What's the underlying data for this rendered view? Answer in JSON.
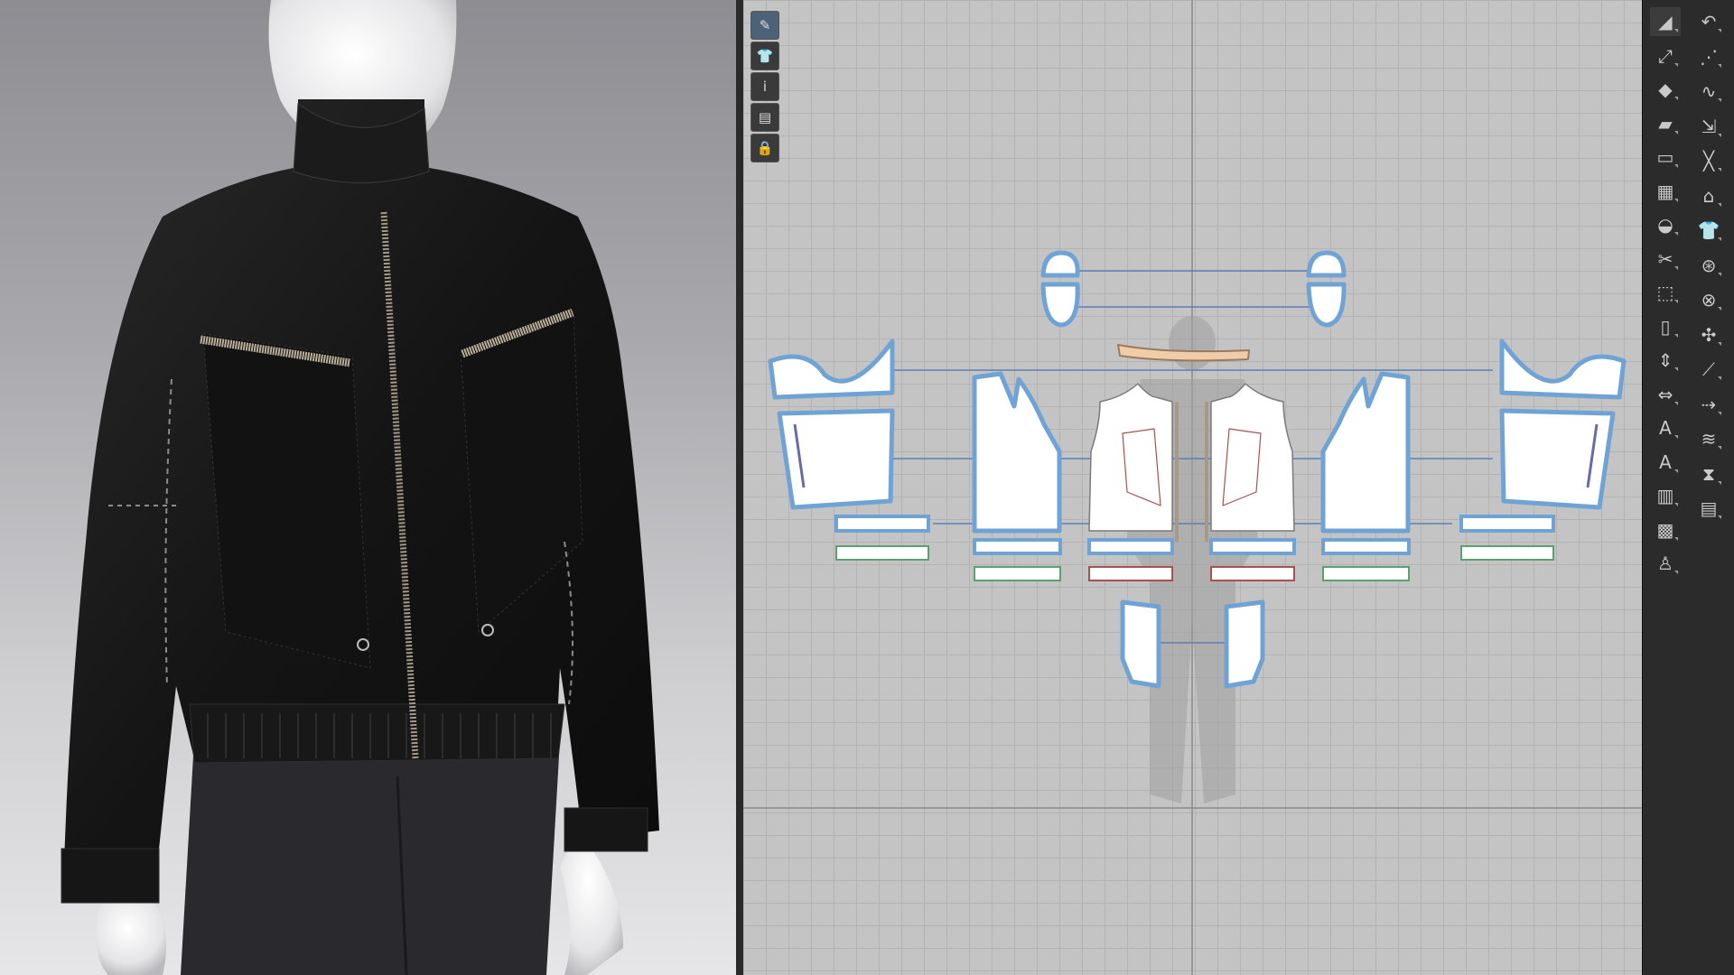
{
  "app": {
    "name": "3D garment pattern editor"
  },
  "colors": {
    "viewport_bg": "#c4c4c4",
    "grid_line": "#b3b3b3",
    "pattern_outline": "#6fa3d6",
    "pattern_fill": "#ffffff",
    "toolbar_bg": "#2b2b2b",
    "jacket": "#141414",
    "zipper": "#a59a86"
  },
  "view_toolbar": [
    {
      "name": "pen-tool-icon",
      "glyph": "✎",
      "active": true
    },
    {
      "name": "garment-view-icon",
      "glyph": "👕",
      "active": false
    },
    {
      "name": "info-icon",
      "glyph": "i",
      "active": false
    },
    {
      "name": "texture-view-icon",
      "glyph": "▤",
      "active": false
    },
    {
      "name": "lock-pattern-icon",
      "glyph": "🔒",
      "active": false
    }
  ],
  "tools_left": [
    {
      "name": "select-move-icon",
      "glyph": "◢",
      "selected": true
    },
    {
      "name": "transform-pattern-icon",
      "glyph": "⤢"
    },
    {
      "name": "edit-point-icon",
      "glyph": "◆"
    },
    {
      "name": "polygon-icon",
      "glyph": "▰"
    },
    {
      "name": "rectangle-icon",
      "glyph": "▭"
    },
    {
      "name": "internal-polygon-icon",
      "glyph": "▦"
    },
    {
      "name": "dart-icon",
      "glyph": "◒"
    },
    {
      "name": "cut-line-icon",
      "glyph": "✂"
    },
    {
      "name": "trace-icon",
      "glyph": "⬚"
    },
    {
      "name": "fold-icon",
      "glyph": "▯"
    },
    {
      "name": "measure-vertical-icon",
      "glyph": "⇕"
    },
    {
      "name": "measure-horizontal-icon",
      "glyph": "⇔"
    },
    {
      "name": "text-annotation-icon",
      "glyph": "A"
    },
    {
      "name": "text-style-icon",
      "glyph": "A"
    },
    {
      "name": "grading-icon",
      "glyph": "▥"
    },
    {
      "name": "fabric-edit-icon",
      "glyph": "▩"
    },
    {
      "name": "avatar-pose-icon",
      "glyph": "♙"
    }
  ],
  "tools_right": [
    {
      "name": "undo-segment-icon",
      "glyph": "↶"
    },
    {
      "name": "sewing-segment-icon",
      "glyph": "⋰"
    },
    {
      "name": "free-sewing-icon",
      "glyph": "∿"
    },
    {
      "name": "seam-check-icon",
      "glyph": "⇲"
    },
    {
      "name": "tack-icon",
      "glyph": "╳"
    },
    {
      "name": "steam-iron-icon",
      "glyph": "⌂"
    },
    {
      "name": "garment-fit-icon",
      "glyph": "👕"
    },
    {
      "name": "button-icon",
      "glyph": "⊛"
    },
    {
      "name": "buttonhole-icon",
      "glyph": "⊗"
    },
    {
      "name": "fold-arrange-icon",
      "glyph": "✣"
    },
    {
      "name": "line-tool-icon",
      "glyph": "⟋"
    },
    {
      "name": "topstitch-icon",
      "glyph": "⇢"
    },
    {
      "name": "puckering-icon",
      "glyph": "≋"
    },
    {
      "name": "zipper-icon",
      "glyph": "⧗"
    },
    {
      "name": "elastic-icon",
      "glyph": "▤"
    }
  ]
}
